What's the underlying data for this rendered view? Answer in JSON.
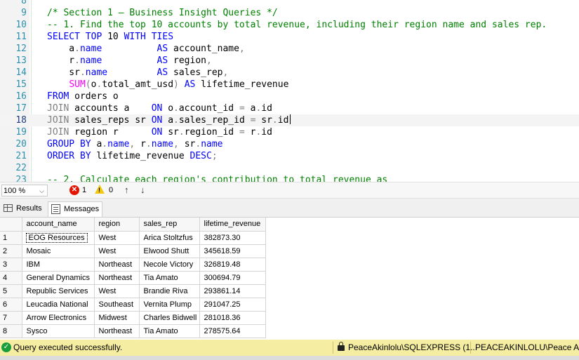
{
  "editor": {
    "lines": [
      {
        "num": "8",
        "tokens": []
      },
      {
        "num": "9",
        "tokens": [
          {
            "t": "/* Section 1 – Business Insight Queries */",
            "c": "cm"
          }
        ]
      },
      {
        "num": "10",
        "tokens": [
          {
            "t": "-- 1. Find the top 10 accounts by total revenue, including their region name and sales rep.",
            "c": "cm"
          }
        ]
      },
      {
        "num": "11",
        "tokens": [
          {
            "t": "SELECT TOP ",
            "c": "kw"
          },
          {
            "t": "10 ",
            "c": ""
          },
          {
            "t": "WITH TIES",
            "c": "kw"
          }
        ]
      },
      {
        "num": "12",
        "tokens": [
          {
            "t": "    a",
            "c": ""
          },
          {
            "t": ".",
            "c": "gray"
          },
          {
            "t": "name          ",
            "c": "kw"
          },
          {
            "t": "AS ",
            "c": "kw"
          },
          {
            "t": "account_name",
            "c": ""
          },
          {
            "t": ",",
            "c": "gray"
          }
        ]
      },
      {
        "num": "13",
        "tokens": [
          {
            "t": "    r",
            "c": ""
          },
          {
            "t": ".",
            "c": "gray"
          },
          {
            "t": "name          ",
            "c": "kw"
          },
          {
            "t": "AS ",
            "c": "kw"
          },
          {
            "t": "region",
            "c": ""
          },
          {
            "t": ",",
            "c": "gray"
          }
        ]
      },
      {
        "num": "14",
        "tokens": [
          {
            "t": "    sr",
            "c": ""
          },
          {
            "t": ".",
            "c": "gray"
          },
          {
            "t": "name         ",
            "c": "kw"
          },
          {
            "t": "AS ",
            "c": "kw"
          },
          {
            "t": "sales_rep",
            "c": ""
          },
          {
            "t": ",",
            "c": "gray"
          }
        ]
      },
      {
        "num": "15",
        "tokens": [
          {
            "t": "    ",
            "c": ""
          },
          {
            "t": "SUM",
            "c": "fn"
          },
          {
            "t": "(",
            "c": "gray"
          },
          {
            "t": "o",
            "c": ""
          },
          {
            "t": ".",
            "c": "gray"
          },
          {
            "t": "total_amt_usd",
            "c": ""
          },
          {
            "t": ") ",
            "c": "gray"
          },
          {
            "t": "AS ",
            "c": "kw"
          },
          {
            "t": "lifetime_revenue",
            "c": ""
          }
        ]
      },
      {
        "num": "16",
        "tokens": [
          {
            "t": "FROM ",
            "c": "kw"
          },
          {
            "t": "orders o",
            "c": ""
          }
        ]
      },
      {
        "num": "17",
        "tokens": [
          {
            "t": "JOIN ",
            "c": "gray"
          },
          {
            "t": "accounts a    ",
            "c": ""
          },
          {
            "t": "ON ",
            "c": "kw"
          },
          {
            "t": "o",
            "c": ""
          },
          {
            "t": ".",
            "c": "gray"
          },
          {
            "t": "account_id ",
            "c": ""
          },
          {
            "t": "= ",
            "c": "gray"
          },
          {
            "t": "a",
            "c": ""
          },
          {
            "t": ".",
            "c": "gray"
          },
          {
            "t": "id",
            "c": ""
          }
        ]
      },
      {
        "num": "18",
        "current": true,
        "tokens": [
          {
            "t": "JOIN ",
            "c": "gray"
          },
          {
            "t": "sales_reps sr ",
            "c": ""
          },
          {
            "t": "ON ",
            "c": "kw"
          },
          {
            "t": "a",
            "c": ""
          },
          {
            "t": ".",
            "c": "gray"
          },
          {
            "t": "sales_rep_id ",
            "c": ""
          },
          {
            "t": "= ",
            "c": "gray"
          },
          {
            "t": "sr",
            "c": ""
          },
          {
            "t": ".",
            "c": "gray"
          },
          {
            "t": "id",
            "c": ""
          }
        ]
      },
      {
        "num": "19",
        "tokens": [
          {
            "t": "JOIN ",
            "c": "gray"
          },
          {
            "t": "region r      ",
            "c": ""
          },
          {
            "t": "ON ",
            "c": "kw"
          },
          {
            "t": "sr",
            "c": ""
          },
          {
            "t": ".",
            "c": "gray"
          },
          {
            "t": "region_id ",
            "c": ""
          },
          {
            "t": "= ",
            "c": "gray"
          },
          {
            "t": "r",
            "c": ""
          },
          {
            "t": ".",
            "c": "gray"
          },
          {
            "t": "id",
            "c": ""
          }
        ]
      },
      {
        "num": "20",
        "tokens": [
          {
            "t": "GROUP BY ",
            "c": "kw"
          },
          {
            "t": "a",
            "c": ""
          },
          {
            "t": ".",
            "c": "gray"
          },
          {
            "t": "name",
            "c": "kw"
          },
          {
            "t": ", ",
            "c": "gray"
          },
          {
            "t": "r",
            "c": ""
          },
          {
            "t": ".",
            "c": "gray"
          },
          {
            "t": "name",
            "c": "kw"
          },
          {
            "t": ", ",
            "c": "gray"
          },
          {
            "t": "sr",
            "c": ""
          },
          {
            "t": ".",
            "c": "gray"
          },
          {
            "t": "name",
            "c": "kw"
          }
        ]
      },
      {
        "num": "21",
        "tokens": [
          {
            "t": "ORDER BY ",
            "c": "kw"
          },
          {
            "t": "lifetime_revenue ",
            "c": ""
          },
          {
            "t": "DESC",
            "c": "kw"
          },
          {
            "t": ";",
            "c": "gray"
          }
        ]
      },
      {
        "num": "22",
        "tokens": []
      },
      {
        "num": "23",
        "tokens": [
          {
            "t": "-- 2. Calculate each region's contribution to total revenue as",
            "c": "cm"
          }
        ]
      }
    ]
  },
  "editor_status": {
    "zoom": "100 %",
    "error_count": "1",
    "warning_count": "0"
  },
  "tabs": {
    "results": "Results",
    "messages": "Messages"
  },
  "grid": {
    "columns": [
      "account_name",
      "region",
      "sales_rep",
      "lifetime_revenue"
    ],
    "rows": [
      {
        "n": "1",
        "cells": [
          "EOG Resources",
          "West",
          "Arica Stoltzfus",
          "382873.30"
        ]
      },
      {
        "n": "2",
        "cells": [
          "Mosaic",
          "West",
          "Elwood Shutt",
          "345618.59"
        ]
      },
      {
        "n": "3",
        "cells": [
          "IBM",
          "Northeast",
          "Necole Victory",
          "326819.48"
        ]
      },
      {
        "n": "4",
        "cells": [
          "General Dynamics",
          "Northeast",
          "Tia Amato",
          "300694.79"
        ]
      },
      {
        "n": "5",
        "cells": [
          "Republic Services",
          "West",
          "Brandie Riva",
          "293861.14"
        ]
      },
      {
        "n": "6",
        "cells": [
          "Leucadia National",
          "Southeast",
          "Vernita Plump",
          "291047.25"
        ]
      },
      {
        "n": "7",
        "cells": [
          "Arrow Electronics",
          "Midwest",
          "Charles Bidwell",
          "281018.36"
        ]
      },
      {
        "n": "8",
        "cells": [
          "Sysco",
          "Northeast",
          "Tia Amato",
          "278575.64"
        ]
      }
    ]
  },
  "statusbar": {
    "message": "Query executed successfully.",
    "server": "PeaceAkinlolu\\SQLEXPRESS (1...",
    "user": "PEACEAKINLOLU\\Peace Ak..."
  }
}
